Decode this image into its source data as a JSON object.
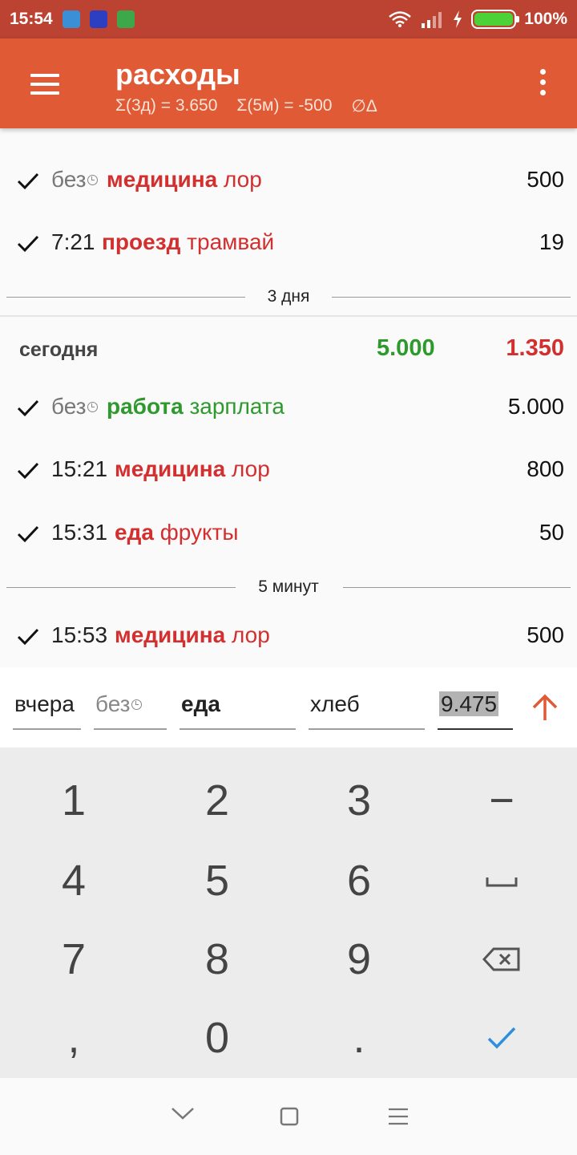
{
  "status_bar": {
    "time": "15:54",
    "battery": "100%",
    "battery_level": 1.0
  },
  "app_bar": {
    "title": "расходы",
    "sum_3d": "Σ(3д) = 3.650",
    "sum_5m": "Σ(5м) = -500",
    "delta": "∅Δ"
  },
  "list": {
    "partial_row_hint": "...",
    "rows_a": [
      {
        "time": "без",
        "muted": true,
        "category": "медицина",
        "note": "лор",
        "amount": "500",
        "color": "red"
      },
      {
        "time": "7:21",
        "muted": false,
        "category": "проезд",
        "note": "трамвай",
        "amount": "19",
        "color": "red"
      }
    ],
    "divider_1": "3 дня",
    "day_header": {
      "name": "сегодня",
      "income": "5.000",
      "expense": "1.350"
    },
    "rows_b": [
      {
        "time": "без",
        "muted": true,
        "category": "работа",
        "note": "зарплата",
        "amount": "5.000",
        "color": "green"
      },
      {
        "time": "15:21",
        "muted": false,
        "category": "медицина",
        "note": "лор",
        "amount": "800",
        "color": "red"
      },
      {
        "time": "15:31",
        "muted": false,
        "category": "еда",
        "note": "фрукты",
        "amount": "50",
        "color": "red"
      }
    ],
    "divider_2": "5 минут",
    "rows_c": [
      {
        "time": "15:53",
        "muted": false,
        "category": "медицина",
        "note": "лор",
        "amount": "500",
        "color": "red"
      }
    ]
  },
  "input_bar": {
    "day": "вчера",
    "time": "без",
    "category": "еда",
    "note": "хлеб",
    "amount": "9.475"
  },
  "keypad": {
    "keys": [
      "1",
      "2",
      "3",
      "−",
      "4",
      "5",
      "6",
      "space",
      "7",
      "8",
      "9",
      "backspace",
      ",",
      "0",
      ".",
      "done"
    ]
  },
  "colors": {
    "status_bar": "#bc4332",
    "app_bar": "#e05a35",
    "expense": "#d32f2f",
    "income": "#2e9a2e",
    "accent_arrow": "#e05a35",
    "done_check": "#2e8fe0"
  }
}
